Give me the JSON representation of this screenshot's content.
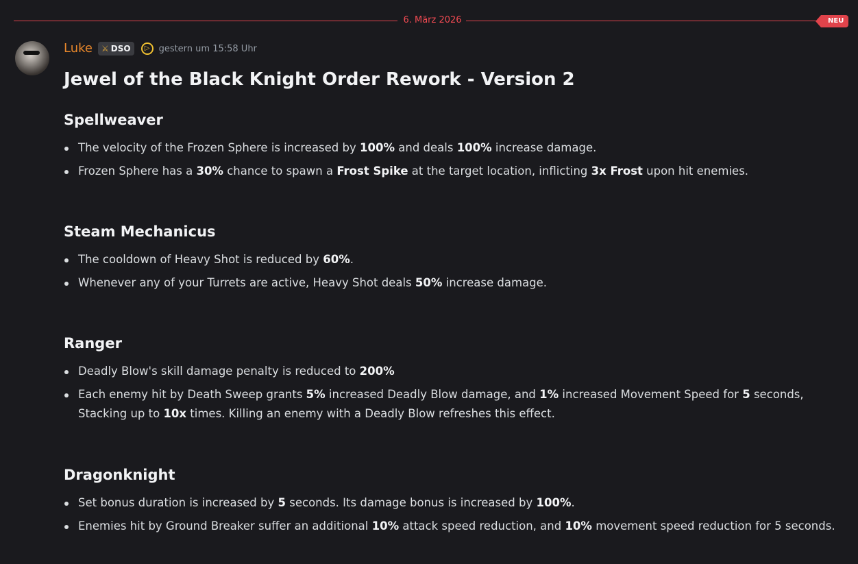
{
  "divider": {
    "date": "6. März 2026",
    "badge": "NEU"
  },
  "message": {
    "username": "Luke",
    "tag": "DSO",
    "timestamp": "gestern um 15:58 Uhr",
    "title": "Jewel of the Black Knight Order Rework - Version 2",
    "sections": [
      {
        "heading": "Spellweaver",
        "items": [
          [
            "The velocity of the Frozen Sphere is increased by ",
            "100%",
            " and deals ",
            "100%",
            " increase damage."
          ],
          [
            "Frozen Sphere has a ",
            "30%",
            " chance to spawn a ",
            "Frost Spike",
            " at the target location, inflicting ",
            "3x Frost",
            " upon hit enemies."
          ]
        ]
      },
      {
        "heading": "Steam Mechanicus",
        "items": [
          [
            "The cooldown of Heavy Shot is reduced by ",
            "60%",
            "."
          ],
          [
            "Whenever any of your Turrets are active, Heavy Shot deals ",
            "50%",
            " increase damage."
          ]
        ]
      },
      {
        "heading": "Ranger",
        "items": [
          [
            "Deadly Blow's skill damage penalty is reduced to ",
            "200%"
          ],
          [
            "Each enemy hit by Death Sweep grants ",
            "5%",
            " increased Deadly Blow damage, and ",
            "1%",
            " increased Movement Speed for ",
            "5",
            " seconds, Stacking up to ",
            "10x",
            " times. Killing an enemy with a Deadly Blow refreshes this effect."
          ]
        ]
      },
      {
        "heading": "Dragonknight",
        "items": [
          [
            "Set bonus duration is increased by ",
            "5",
            " seconds. Its damage bonus is increased by ",
            "100%",
            "."
          ],
          [
            "Enemies hit by Ground Breaker suffer an additional ",
            "10%",
            " attack speed reduction, and ",
            "10%",
            " movement speed reduction for 5 seconds."
          ]
        ]
      }
    ]
  }
}
